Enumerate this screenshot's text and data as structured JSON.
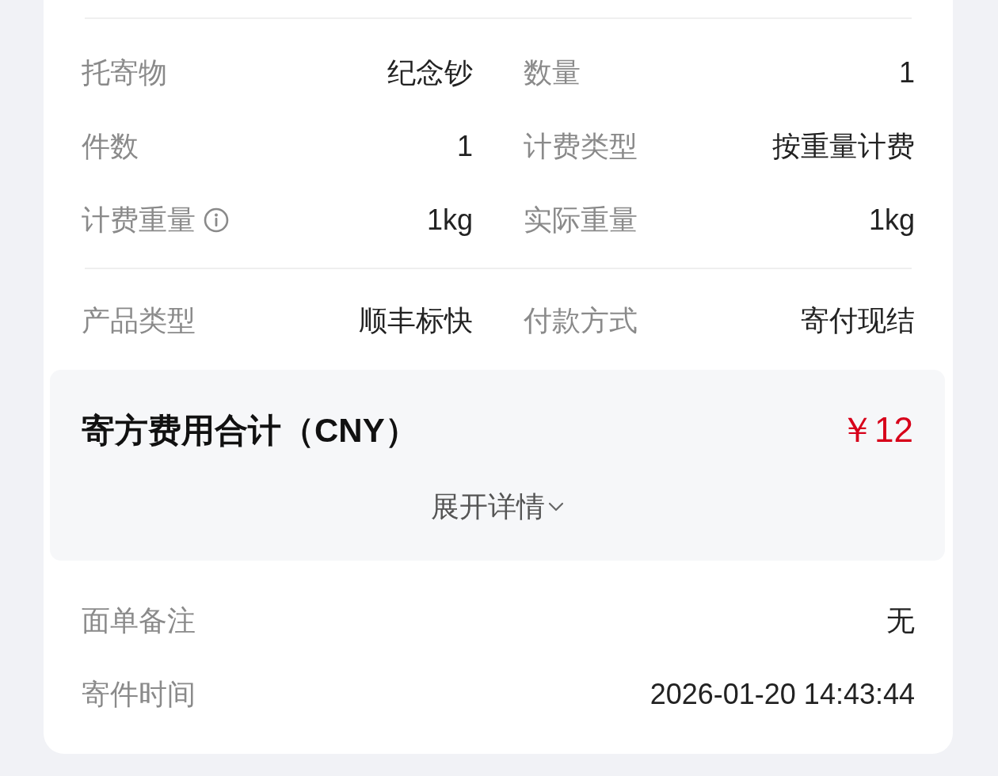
{
  "detail_sections": [
    {
      "items": [
        {
          "label": "托寄物",
          "value": "纪念钞",
          "info_icon": false
        },
        {
          "label": "数量",
          "value": "1",
          "info_icon": false
        },
        {
          "label": "件数",
          "value": "1",
          "info_icon": false
        },
        {
          "label": "计费类型",
          "value": "按重量计费",
          "info_icon": false
        },
        {
          "label": "计费重量",
          "value": "1kg",
          "info_icon": true
        },
        {
          "label": "实际重量",
          "value": "1kg",
          "info_icon": false
        }
      ]
    },
    {
      "items": [
        {
          "label": "产品类型",
          "value": "顺丰标快",
          "info_icon": false
        },
        {
          "label": "付款方式",
          "value": "寄付现结",
          "info_icon": false
        }
      ]
    }
  ],
  "fee_summary": {
    "title": "寄方费用合计（CNY）",
    "amount": "￥12",
    "expand_label": "展开详情",
    "expanded": false
  },
  "remarks": [
    {
      "label": "面单备注",
      "value": "无"
    },
    {
      "label": "寄件时间",
      "value": "2026-01-20 14:43:44"
    }
  ]
}
